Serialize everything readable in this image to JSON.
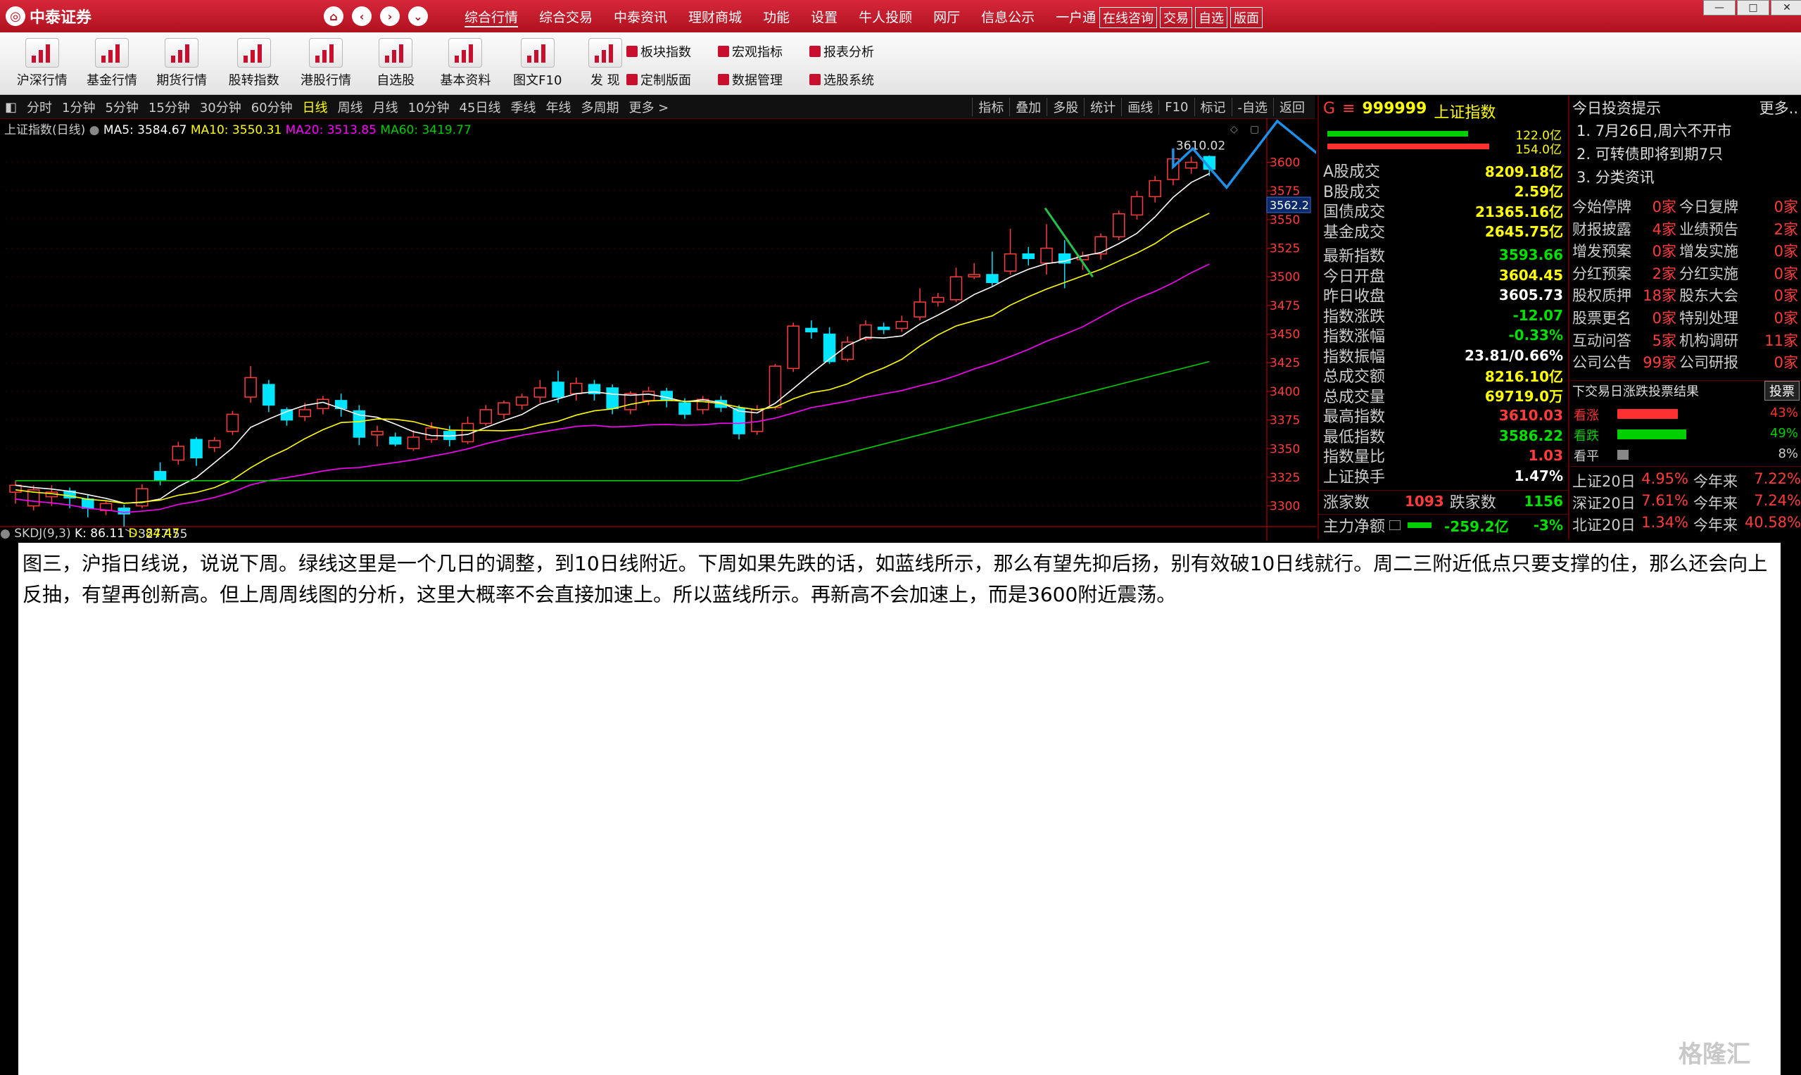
{
  "app": {
    "brand": "中泰证券"
  },
  "menu": [
    "综合行情",
    "综合交易",
    "中泰资讯",
    "理财商城",
    "功能",
    "设置",
    "牛人投顾",
    "网厅",
    "信息公示",
    "一户通"
  ],
  "title_buttons": [
    "在线咨询",
    "交易",
    "自选",
    "版面"
  ],
  "toolbar": {
    "big": [
      "沪深行情",
      "基金行情",
      "期货行情",
      "股转指数",
      "港股行情",
      "自选股",
      "基本资料",
      "图文F10",
      "发 现"
    ],
    "small": [
      "板块指数",
      "宏观指标",
      "报表分析",
      "定制版面",
      "数据管理",
      "选股系统"
    ]
  },
  "periods": [
    "分时",
    "1分钟",
    "5分钟",
    "15分钟",
    "30分钟",
    "60分钟",
    "日线",
    "周线",
    "月线",
    "10分钟",
    "45日线",
    "季线",
    "年线",
    "多周期",
    "更多 >"
  ],
  "active_period": "日线",
  "chart_tools": [
    "指标",
    "叠加",
    "多股",
    "统计",
    "画线",
    "F10",
    "标记",
    "-自选",
    "返回"
  ],
  "chart_header": {
    "name": "上证指数(日线)",
    "ma5": "MA5: 3584.67",
    "ma10": "MA10: 3550.31",
    "ma20": "MA20: 3513.85",
    "ma60": "MA60: 3419.77"
  },
  "kpanel": {
    "name": "SKDJ(9,3)",
    "k": "K: 86.11",
    "d": "D: 84.47"
  },
  "chart_data": {
    "type": "candlestick",
    "y_ticks": [
      3300,
      3325,
      3350,
      3375,
      3400,
      3425,
      3450,
      3475,
      3500,
      3525,
      3550,
      3575,
      3600
    ],
    "ylim": [
      3285,
      3620
    ],
    "current_price_label": "3562.2",
    "high_label": "3610.02",
    "low_label": "3277.55",
    "candles": [
      [
        3312,
        3318,
        3302,
        3322
      ],
      [
        3300,
        3314,
        3296,
        3318
      ],
      [
        3308,
        3312,
        3300,
        3318
      ],
      [
        3313,
        3307,
        3298,
        3316
      ],
      [
        3306,
        3298,
        3290,
        3310
      ],
      [
        3296,
        3302,
        3292,
        3305
      ],
      [
        3298,
        3293,
        3282,
        3301
      ],
      [
        3300,
        3315,
        3298,
        3319
      ],
      [
        3330,
        3322,
        3318,
        3338
      ],
      [
        3340,
        3352,
        3336,
        3356
      ],
      [
        3358,
        3342,
        3335,
        3360
      ],
      [
        3351,
        3357,
        3347,
        3360
      ],
      [
        3365,
        3380,
        3362,
        3383
      ],
      [
        3395,
        3412,
        3390,
        3422
      ],
      [
        3406,
        3388,
        3382,
        3410
      ],
      [
        3384,
        3375,
        3370,
        3386
      ],
      [
        3378,
        3384,
        3374,
        3390
      ],
      [
        3385,
        3393,
        3380,
        3396
      ],
      [
        3392,
        3385,
        3378,
        3398
      ],
      [
        3383,
        3360,
        3353,
        3388
      ],
      [
        3362,
        3365,
        3352,
        3370
      ],
      [
        3360,
        3354,
        3352,
        3364
      ],
      [
        3350,
        3360,
        3348,
        3366
      ],
      [
        3358,
        3368,
        3355,
        3373
      ],
      [
        3365,
        3358,
        3352,
        3370
      ],
      [
        3356,
        3372,
        3354,
        3378
      ],
      [
        3372,
        3384,
        3370,
        3388
      ],
      [
        3380,
        3390,
        3376,
        3392
      ],
      [
        3388,
        3395,
        3384,
        3398
      ],
      [
        3395,
        3403,
        3390,
        3410
      ],
      [
        3408,
        3395,
        3390,
        3418
      ],
      [
        3398,
        3407,
        3392,
        3412
      ],
      [
        3406,
        3398,
        3392,
        3410
      ],
      [
        3403,
        3385,
        3380,
        3406
      ],
      [
        3384,
        3398,
        3380,
        3400
      ],
      [
        3392,
        3400,
        3388,
        3404
      ],
      [
        3400,
        3392,
        3386,
        3403
      ],
      [
        3390,
        3380,
        3376,
        3394
      ],
      [
        3384,
        3393,
        3380,
        3396
      ],
      [
        3392,
        3386,
        3382,
        3396
      ],
      [
        3385,
        3363,
        3358,
        3388
      ],
      [
        3365,
        3384,
        3362,
        3388
      ],
      [
        3386,
        3422,
        3384,
        3424
      ],
      [
        3420,
        3457,
        3417,
        3460
      ],
      [
        3455,
        3452,
        3446,
        3462
      ],
      [
        3450,
        3426,
        3424,
        3456
      ],
      [
        3428,
        3443,
        3426,
        3448
      ],
      [
        3446,
        3458,
        3444,
        3462
      ],
      [
        3456,
        3454,
        3450,
        3460
      ],
      [
        3455,
        3461,
        3452,
        3466
      ],
      [
        3465,
        3478,
        3462,
        3490
      ],
      [
        3478,
        3482,
        3474,
        3486
      ],
      [
        3480,
        3500,
        3478,
        3508
      ],
      [
        3500,
        3502,
        3498,
        3512
      ],
      [
        3502,
        3495,
        3492,
        3522
      ],
      [
        3505,
        3520,
        3502,
        3542
      ],
      [
        3520,
        3516,
        3510,
        3526
      ],
      [
        3512,
        3525,
        3502,
        3546
      ],
      [
        3520,
        3512,
        3490,
        3532
      ],
      [
        3515,
        3518,
        3506,
        3522
      ],
      [
        3520,
        3535,
        3515,
        3538
      ],
      [
        3535,
        3555,
        3532,
        3558
      ],
      [
        3554,
        3570,
        3550,
        3575
      ],
      [
        3570,
        3584,
        3565,
        3588
      ],
      [
        3585,
        3603,
        3580,
        3610
      ],
      [
        3595,
        3600,
        3590,
        3605
      ],
      [
        3605,
        3594,
        3588,
        3606
      ]
    ],
    "ma": {
      "MA5": {
        "color": "#ffffff"
      },
      "MA10": {
        "color": "#ffff00"
      },
      "MA20": {
        "color": "#ff00ff"
      },
      "MA60": {
        "color": "#00cc00"
      }
    }
  },
  "quote": {
    "code": "999999",
    "name": "上证指数",
    "vol_top": "122.0亿",
    "vol_bot": "154.0亿",
    "rows": [
      {
        "l": "A股成交",
        "v": "8209.18亿",
        "c": "yellow"
      },
      {
        "l": "B股成交",
        "v": "2.59亿",
        "c": "yellow"
      },
      {
        "l": "国债成交",
        "v": "21365.16亿",
        "c": "yellow"
      },
      {
        "l": "基金成交",
        "v": "2645.75亿",
        "c": "yellow"
      },
      {
        "l": "最新指数",
        "v": "3593.66",
        "c": "green"
      },
      {
        "l": "今日开盘",
        "v": "3604.45",
        "c": "yellow"
      },
      {
        "l": "昨日收盘",
        "v": "3605.73",
        "c": "white"
      },
      {
        "l": "指数涨跌",
        "v": "-12.07",
        "c": "green"
      },
      {
        "l": "指数涨幅",
        "v": "-0.33%",
        "c": "green"
      },
      {
        "l": "指数振幅",
        "v": "23.81/0.66%",
        "c": "white"
      },
      {
        "l": "总成交额",
        "v": "8216.10亿",
        "c": "yellow"
      },
      {
        "l": "总成交量",
        "v": "69719.0万",
        "c": "yellow"
      },
      {
        "l": "最高指数",
        "v": "3610.03",
        "c": "red"
      },
      {
        "l": "最低指数",
        "v": "3586.22",
        "c": "green"
      },
      {
        "l": "指数量比",
        "v": "1.03",
        "c": "red"
      },
      {
        "l": "上证换手",
        "v": "1.47%",
        "c": "white"
      }
    ],
    "up_label": "涨家数",
    "up_value": "1093",
    "down_label": "跌家数",
    "down_value": "1156",
    "main_flow_label": "主力净额",
    "main_flow_value": "-259.2亿",
    "main_flow_pct": "-3%"
  },
  "news": {
    "title": "今日投资提示",
    "more": "更多..",
    "items": [
      "1. 7月26日,周六不开市",
      "2. 可转债即将到期7只",
      "3. 分类资讯"
    ],
    "stats": [
      [
        "今始停牌",
        "0家",
        "今日复牌",
        "0家"
      ],
      [
        "财报披露",
        "4家",
        "业绩预告",
        "2家"
      ],
      [
        "增发预案",
        "0家",
        "增发实施",
        "0家"
      ],
      [
        "分红预案",
        "2家",
        "分红实施",
        "0家"
      ],
      [
        "股权质押",
        "18家",
        "股东大会",
        "0家"
      ],
      [
        "股票更名",
        "0家",
        "特别处理",
        "0家"
      ],
      [
        "互动问答",
        "5家",
        "机构调研",
        "11家"
      ],
      [
        "公司公告",
        "99家",
        "公司研报",
        "0家"
      ]
    ],
    "vote_title": "下交易日涨跌投票结果",
    "vote_btn": "投票",
    "votes": [
      {
        "label": "看涨",
        "pct": "43%",
        "value": 43,
        "color": "#ff3030"
      },
      {
        "label": "看跌",
        "pct": "49%",
        "value": 49,
        "color": "#00d000"
      },
      {
        "label": "看平",
        "pct": "8%",
        "value": 8,
        "color": "#888888"
      }
    ],
    "perf": [
      [
        "上证20日",
        "4.95%",
        "今年来",
        "7.22%"
      ],
      [
        "深证20日",
        "7.61%",
        "今年来",
        "7.24%"
      ],
      [
        "北证20日",
        "1.34%",
        "今年来",
        "40.58%"
      ]
    ]
  },
  "annotation": "图三，沪指日线说，说说下周。绿线这里是一个几日的调整，到10日线附近。下周如果先跌的话，如蓝线所示，那么有望先抑后扬，别有效破10日线就行。周二三附近低点只要支撑的住，那么还会向上反抽，有望再创新高。但上周周线图的分析，这里大概率不会直接加速上。所以蓝线所示。再新高不会加速上，而是3600附近震荡。",
  "watermark": "格隆汇"
}
